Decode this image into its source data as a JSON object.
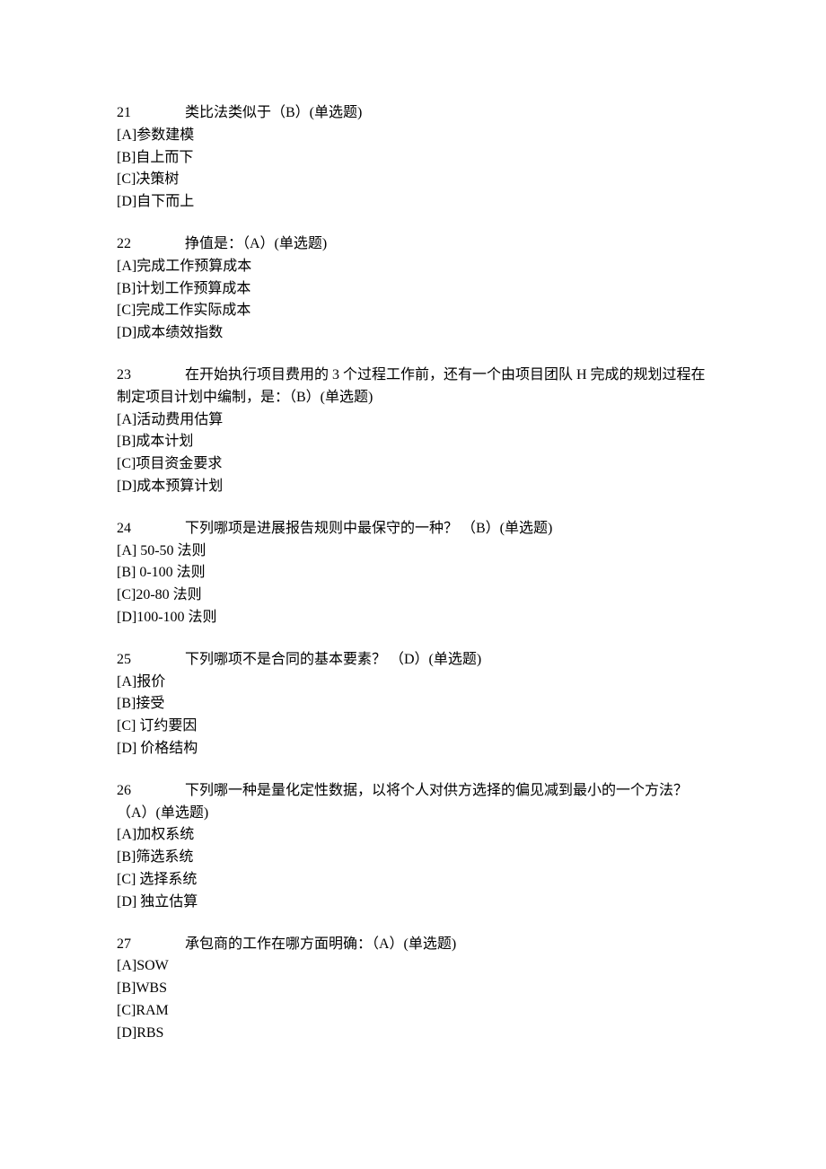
{
  "questions": [
    {
      "number": "21",
      "stem": "类比法类似于（B）(单选题)",
      "options": [
        "[A]参数建模",
        "[B]自上而下",
        "[C]决策树",
        "[D]自下而上"
      ]
    },
    {
      "number": "22",
      "stem": "挣值是：（A）(单选题)",
      "options": [
        "[A]完成工作预算成本",
        "[B]计划工作预算成本",
        "[C]完成工作实际成本",
        "[D]成本绩效指数"
      ]
    },
    {
      "number": "23",
      "stem": "在开始执行项目费用的 3 个过程工作前，还有一个由项目团队 H 完成的规划过程在制定项目计划中编制，是：（B）(单选题)",
      "options": [
        "[A]活动费用估算",
        "[B]成本计划",
        "[C]项目资金要求",
        "[D]成本预算计划"
      ]
    },
    {
      "number": "24",
      "stem": "下列哪项是进展报告规则中最保守的一种？ （B）(单选题)",
      "options": [
        "[A] 50-50 法则",
        "[B] 0-100 法则",
        "[C]20-80 法则",
        "[D]100-100 法则"
      ]
    },
    {
      "number": "25",
      "stem": "下列哪项不是合同的基本要素？ （D）(单选题)",
      "options": [
        "[A]报价",
        "[B]接受",
        "[C] 订约要因",
        "[D] 价格结构"
      ]
    },
    {
      "number": "26",
      "stem": "下列哪一种是量化定性数据，以将个人对供方选择的偏见减到最小的一个方法？ （A）(单选题)",
      "options": [
        "[A]加权系统",
        "[B]筛选系统",
        "[C] 选择系统",
        "[D] 独立估算"
      ]
    },
    {
      "number": "27",
      "stem": "承包商的工作在哪方面明确：（A）(单选题)",
      "options": [
        "[A]SOW",
        "[B]WBS",
        "[C]RAM",
        "[D]RBS"
      ]
    }
  ]
}
